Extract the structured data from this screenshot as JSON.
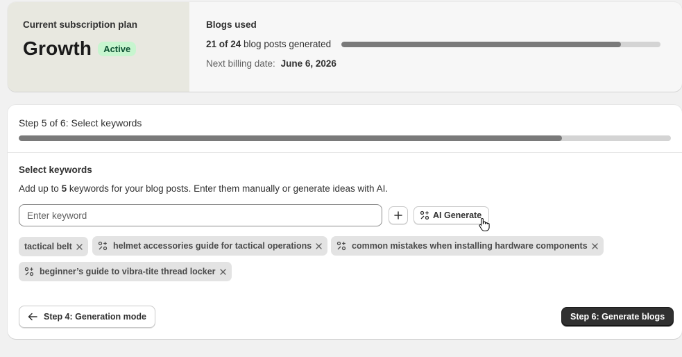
{
  "plan": {
    "label": "Current subscription plan",
    "name": "Growth",
    "status": "Active",
    "blogs_title": "Blogs used",
    "used_count": "21 of 24",
    "used_suffix": "blog posts generated",
    "used": 21,
    "total": 24,
    "billing_label": "Next billing date:",
    "billing_date": "June 6, 2026"
  },
  "step": {
    "title": "Step 5 of 6: Select keywords",
    "current": 5,
    "total": 6,
    "section_title": "Select keywords",
    "desc_pre": "Add up to",
    "desc_max": "5",
    "desc_post": "keywords for your blog posts. Enter them manually or generate ideas with AI.",
    "input_placeholder": "Enter keyword",
    "ai_button_label": "AI Generate",
    "keywords": [
      {
        "label": "tactical belt",
        "ai": false
      },
      {
        "label": "helmet accessories guide for tactical operations",
        "ai": true
      },
      {
        "label": "common mistakes when installing hardware components",
        "ai": true
      },
      {
        "label": "beginner’s guide to vibra-tite thread locker",
        "ai": true
      }
    ],
    "back_label": "Step 4: Generation mode",
    "next_label": "Step 6: Generate blogs"
  },
  "icons": {
    "add": "plus-icon",
    "ai": "ai-sparkle-icon",
    "remove": "close-icon",
    "back": "arrow-left-icon",
    "cursor": "pointer-hand-cursor"
  },
  "colors": {
    "active_badge_bg": "#c7f5cf",
    "active_badge_text": "#0c5132",
    "progress_fill": "#7a7a7a",
    "primary_button": "#303030"
  }
}
